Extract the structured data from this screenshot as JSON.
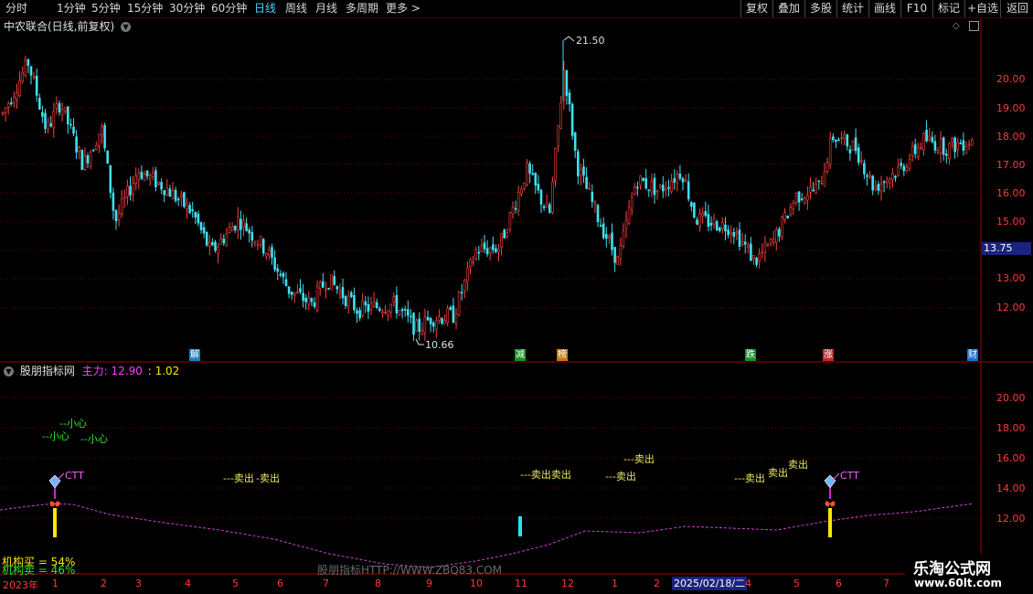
{
  "toolbar": {
    "periods": [
      "分时",
      "1分钟",
      "5分钟",
      "15分钟",
      "30分钟",
      "60分钟",
      "日线",
      "周线",
      "月线",
      "多周期",
      "更多 >"
    ],
    "active_period": "日线",
    "buttons": [
      "复权",
      "叠加",
      "多股",
      "统计",
      "画线",
      "F10",
      "标记",
      "+自选",
      "返回"
    ]
  },
  "main_panel": {
    "title": "中农联合(日线,前复权)",
    "price_labels": [
      "20.00",
      "19.00",
      "18.00",
      "17.00",
      "16.00",
      "15.00",
      "14.00",
      "13.00",
      "12.00"
    ],
    "current_price": "13.75",
    "high_label": "21.50",
    "low_label": "10.66",
    "event_markers": [
      {
        "text": "解",
        "color": "#1e7fbf"
      },
      {
        "text": "减",
        "color": "#1b8f2a"
      },
      {
        "text": "榜",
        "color": "#c87a10"
      },
      {
        "text": "跌",
        "color": "#1b8f2a"
      },
      {
        "text": "涨",
        "color": "#c0282c"
      },
      {
        "text": "财",
        "color": "#1e6fcf"
      }
    ]
  },
  "indicator_panel": {
    "name": "股朋指标网",
    "main_force_label": "主力: 12.90",
    "main_force_value2": ": 1.02",
    "axis_labels": [
      "20.00",
      "18.00",
      "16.00",
      "14.00",
      "12.00"
    ],
    "annotations": {
      "caution": [
        "--小心",
        "--小心",
        "--小心"
      ],
      "sell": [
        "---卖出",
        "-卖出",
        "---卖出卖出",
        "---卖出",
        "---卖出",
        "---卖出",
        "卖出",
        "卖出"
      ],
      "ctt": [
        "CTT",
        "CTT"
      ]
    },
    "inst_buy": "机构买 = 54%",
    "inst_sell": "机构卖 = 46%",
    "watermark": "股朋指标HTTP://WWW.ZBQ83.COM"
  },
  "time_axis": {
    "year": "2023年",
    "months": [
      "1",
      "2",
      "3",
      "4",
      "5",
      "6",
      "7",
      "8",
      "9",
      "10",
      "11",
      "12",
      "1",
      "2",
      "3",
      "4",
      "5",
      "6",
      "7"
    ],
    "cursor_date": "2025/02/18/二"
  },
  "branding": {
    "site_name": "乐淘公式网",
    "site_url": "www.60lt.com"
  },
  "colors": {
    "up": "#ff4040",
    "down": "#40e0f0",
    "grid": "#7a0000",
    "axis_text": "#ff3a3a",
    "purple_line": "#d040d0"
  }
}
